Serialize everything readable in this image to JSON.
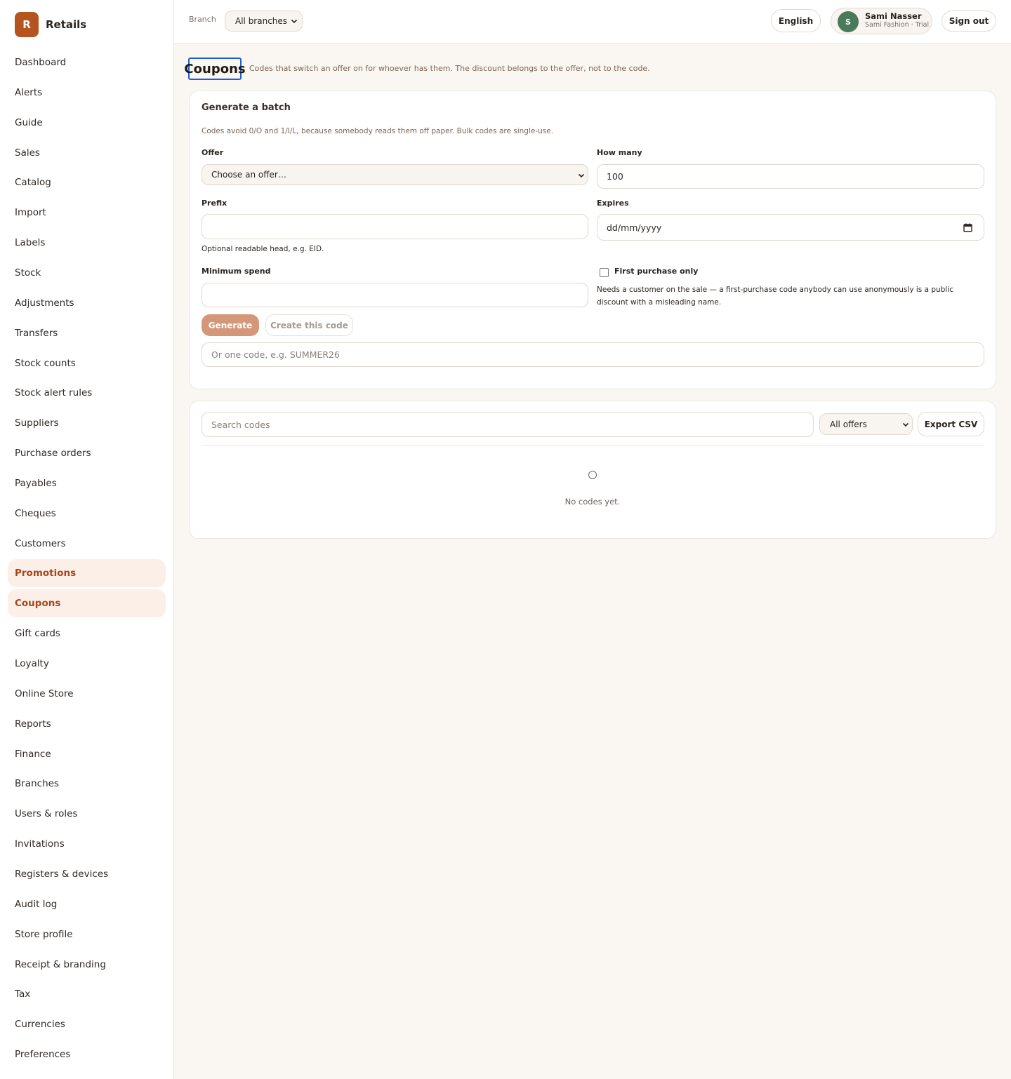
{
  "brand": {
    "logo_letter": "R",
    "name": "Retails",
    "accent": "#b5541f"
  },
  "sidebar": {
    "items": [
      {
        "label": "Dashboard",
        "active": false
      },
      {
        "label": "Alerts",
        "active": false
      },
      {
        "label": "Guide",
        "active": false
      },
      {
        "label": "Sales",
        "active": false
      },
      {
        "label": "Catalog",
        "active": false
      },
      {
        "label": "Import",
        "active": false
      },
      {
        "label": "Labels",
        "active": false
      },
      {
        "label": "Stock",
        "active": false
      },
      {
        "label": "Adjustments",
        "active": false
      },
      {
        "label": "Transfers",
        "active": false
      },
      {
        "label": "Stock counts",
        "active": false
      },
      {
        "label": "Stock alert rules",
        "active": false
      },
      {
        "label": "Suppliers",
        "active": false
      },
      {
        "label": "Purchase orders",
        "active": false
      },
      {
        "label": "Payables",
        "active": false
      },
      {
        "label": "Cheques",
        "active": false
      },
      {
        "label": "Customers",
        "active": false
      },
      {
        "label": "Promotions",
        "active": true
      },
      {
        "label": "Coupons",
        "active": true
      },
      {
        "label": "Gift cards",
        "active": false
      },
      {
        "label": "Loyalty",
        "active": false
      },
      {
        "label": "Online Store",
        "active": false
      },
      {
        "label": "Reports",
        "active": false
      },
      {
        "label": "Finance",
        "active": false
      },
      {
        "label": "Branches",
        "active": false
      },
      {
        "label": "Users & roles",
        "active": false
      },
      {
        "label": "Invitations",
        "active": false
      },
      {
        "label": "Registers & devices",
        "active": false
      },
      {
        "label": "Audit log",
        "active": false
      },
      {
        "label": "Store profile",
        "active": false
      },
      {
        "label": "Receipt & branding",
        "active": false
      },
      {
        "label": "Tax",
        "active": false
      },
      {
        "label": "Currencies",
        "active": false
      },
      {
        "label": "Preferences",
        "active": false
      }
    ]
  },
  "topbar": {
    "branch_label": "Branch",
    "branch_value": "All branches",
    "language": "English",
    "user": {
      "initial": "S",
      "name": "Sami Nasser",
      "subtitle": "Sami Fashion · Trial",
      "avatar_color": "#4a7a5a"
    },
    "signout": "Sign out"
  },
  "page": {
    "title": "Coupons",
    "description": "Codes that switch an offer on for whoever has them. The discount belongs to the offer, not to the code."
  },
  "generate": {
    "title": "Generate a batch",
    "hint": "Codes avoid 0/O and 1/I/L, because somebody reads them off paper. Bulk codes are single-use.",
    "offer_label": "Offer",
    "offer_value": "Choose an offer…",
    "how_many_label": "How many",
    "how_many_value": "100",
    "prefix_label": "Prefix",
    "prefix_value": "",
    "prefix_note": "Optional readable head, e.g. EID.",
    "expires_label": "Expires",
    "expires_placeholder": "dd/mm/yyyy",
    "min_spend_label": "Minimum spend",
    "min_spend_value": "",
    "first_purchase_label": "First purchase only",
    "first_purchase_checked": false,
    "first_purchase_note": "Needs a customer on the sale — a first-purchase code anybody can use anonymously is a public discount with a misleading name.",
    "generate_button": "Generate",
    "create_button": "Create this code",
    "single_code_placeholder": "Or one code, e.g. SUMMER26"
  },
  "list": {
    "search_placeholder": "Search codes",
    "filter_value": "All offers",
    "export_button": "Export CSV",
    "empty_text": "No codes yet."
  }
}
